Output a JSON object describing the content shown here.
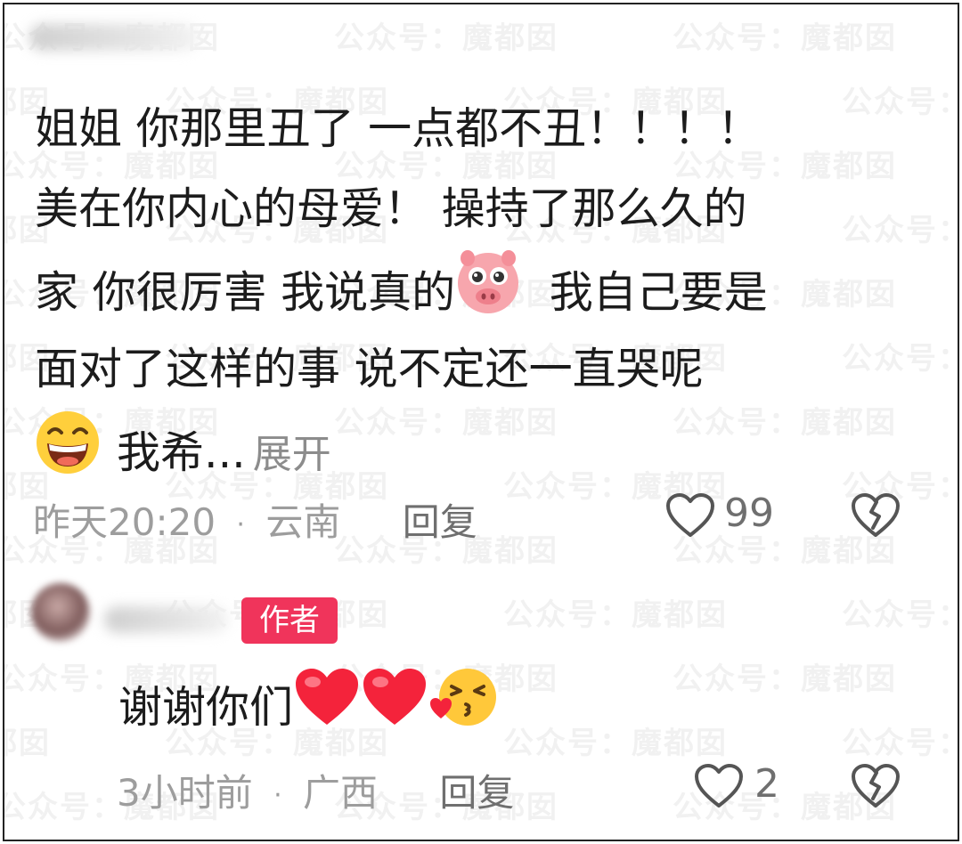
{
  "watermark": {
    "text": "公众号：魔都囡"
  },
  "comment1": {
    "lines": [
      "姐姐 你那里丑了  一点都不丑！！！！",
      "美在你内心的母爱！ 操持了那么久的",
      "家 你很厉害 我说真的",
      "我自己要是",
      "面对了这样的事 说不定还一直哭呢",
      "我希..."
    ],
    "expand_label": "展开",
    "time": "昨天20:20",
    "separator": "·",
    "location": "云南",
    "reply_label": "回复",
    "like_count": "99",
    "emojis": [
      "pig-face-emoji",
      "grinning-emoji"
    ]
  },
  "comment2": {
    "author_badge": "作者",
    "text": "谢谢你们",
    "time": "3小时前",
    "separator": "·",
    "location": "广西",
    "reply_label": "回复",
    "like_count": "2",
    "emojis": [
      "red-heart-emoji",
      "red-heart-emoji",
      "blowing-kiss-emoji"
    ]
  },
  "colors": {
    "badge": "#f0345b",
    "meta": "#9d9d9d",
    "text": "#1c1c1c"
  }
}
